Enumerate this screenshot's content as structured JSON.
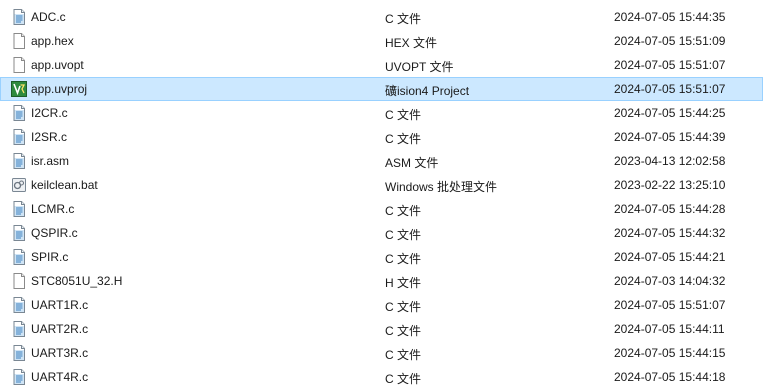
{
  "files": [
    {
      "name": "ADC.c",
      "type": "C 文件",
      "date": "2024-07-05 15:44:35",
      "icon": "c-source-file-icon",
      "selected": false
    },
    {
      "name": "app.hex",
      "type": "HEX 文件",
      "date": "2024-07-05 15:51:09",
      "icon": "blank-file-icon",
      "selected": false
    },
    {
      "name": "app.uvopt",
      "type": "UVOPT 文件",
      "date": "2024-07-05 15:51:07",
      "icon": "blank-file-icon",
      "selected": false
    },
    {
      "name": "app.uvproj",
      "type": "礦ision4 Project",
      "date": "2024-07-05 15:51:07",
      "icon": "keil-project-icon",
      "selected": true
    },
    {
      "name": "I2CR.c",
      "type": "C 文件",
      "date": "2024-07-05 15:44:25",
      "icon": "c-source-file-icon",
      "selected": false
    },
    {
      "name": "I2SR.c",
      "type": "C 文件",
      "date": "2024-07-05 15:44:39",
      "icon": "c-source-file-icon",
      "selected": false
    },
    {
      "name": "isr.asm",
      "type": "ASM 文件",
      "date": "2023-04-13 12:02:58",
      "icon": "c-source-file-icon",
      "selected": false
    },
    {
      "name": "keilclean.bat",
      "type": "Windows 批处理文件",
      "date": "2023-02-22 13:25:10",
      "icon": "batch-file-icon",
      "selected": false
    },
    {
      "name": "LCMR.c",
      "type": "C 文件",
      "date": "2024-07-05 15:44:28",
      "icon": "c-source-file-icon",
      "selected": false
    },
    {
      "name": "QSPIR.c",
      "type": "C 文件",
      "date": "2024-07-05 15:44:32",
      "icon": "c-source-file-icon",
      "selected": false
    },
    {
      "name": "SPIR.c",
      "type": "C 文件",
      "date": "2024-07-05 15:44:21",
      "icon": "c-source-file-icon",
      "selected": false
    },
    {
      "name": "STC8051U_32.H",
      "type": "H 文件",
      "date": "2024-07-03 14:04:32",
      "icon": "blank-file-icon",
      "selected": false
    },
    {
      "name": "UART1R.c",
      "type": "C 文件",
      "date": "2024-07-05 15:51:07",
      "icon": "c-source-file-icon",
      "selected": false
    },
    {
      "name": "UART2R.c",
      "type": "C 文件",
      "date": "2024-07-05 15:44:11",
      "icon": "c-source-file-icon",
      "selected": false
    },
    {
      "name": "UART3R.c",
      "type": "C 文件",
      "date": "2024-07-05 15:44:15",
      "icon": "c-source-file-icon",
      "selected": false
    },
    {
      "name": "UART4R.c",
      "type": "C 文件",
      "date": "2024-07-05 15:44:18",
      "icon": "c-source-file-icon",
      "selected": false
    }
  ],
  "colors": {
    "selected_background": "#cce8ff",
    "selected_border": "#99d1ff",
    "text": "#1a1a1a",
    "c_icon_accent": "#4a90c8"
  }
}
